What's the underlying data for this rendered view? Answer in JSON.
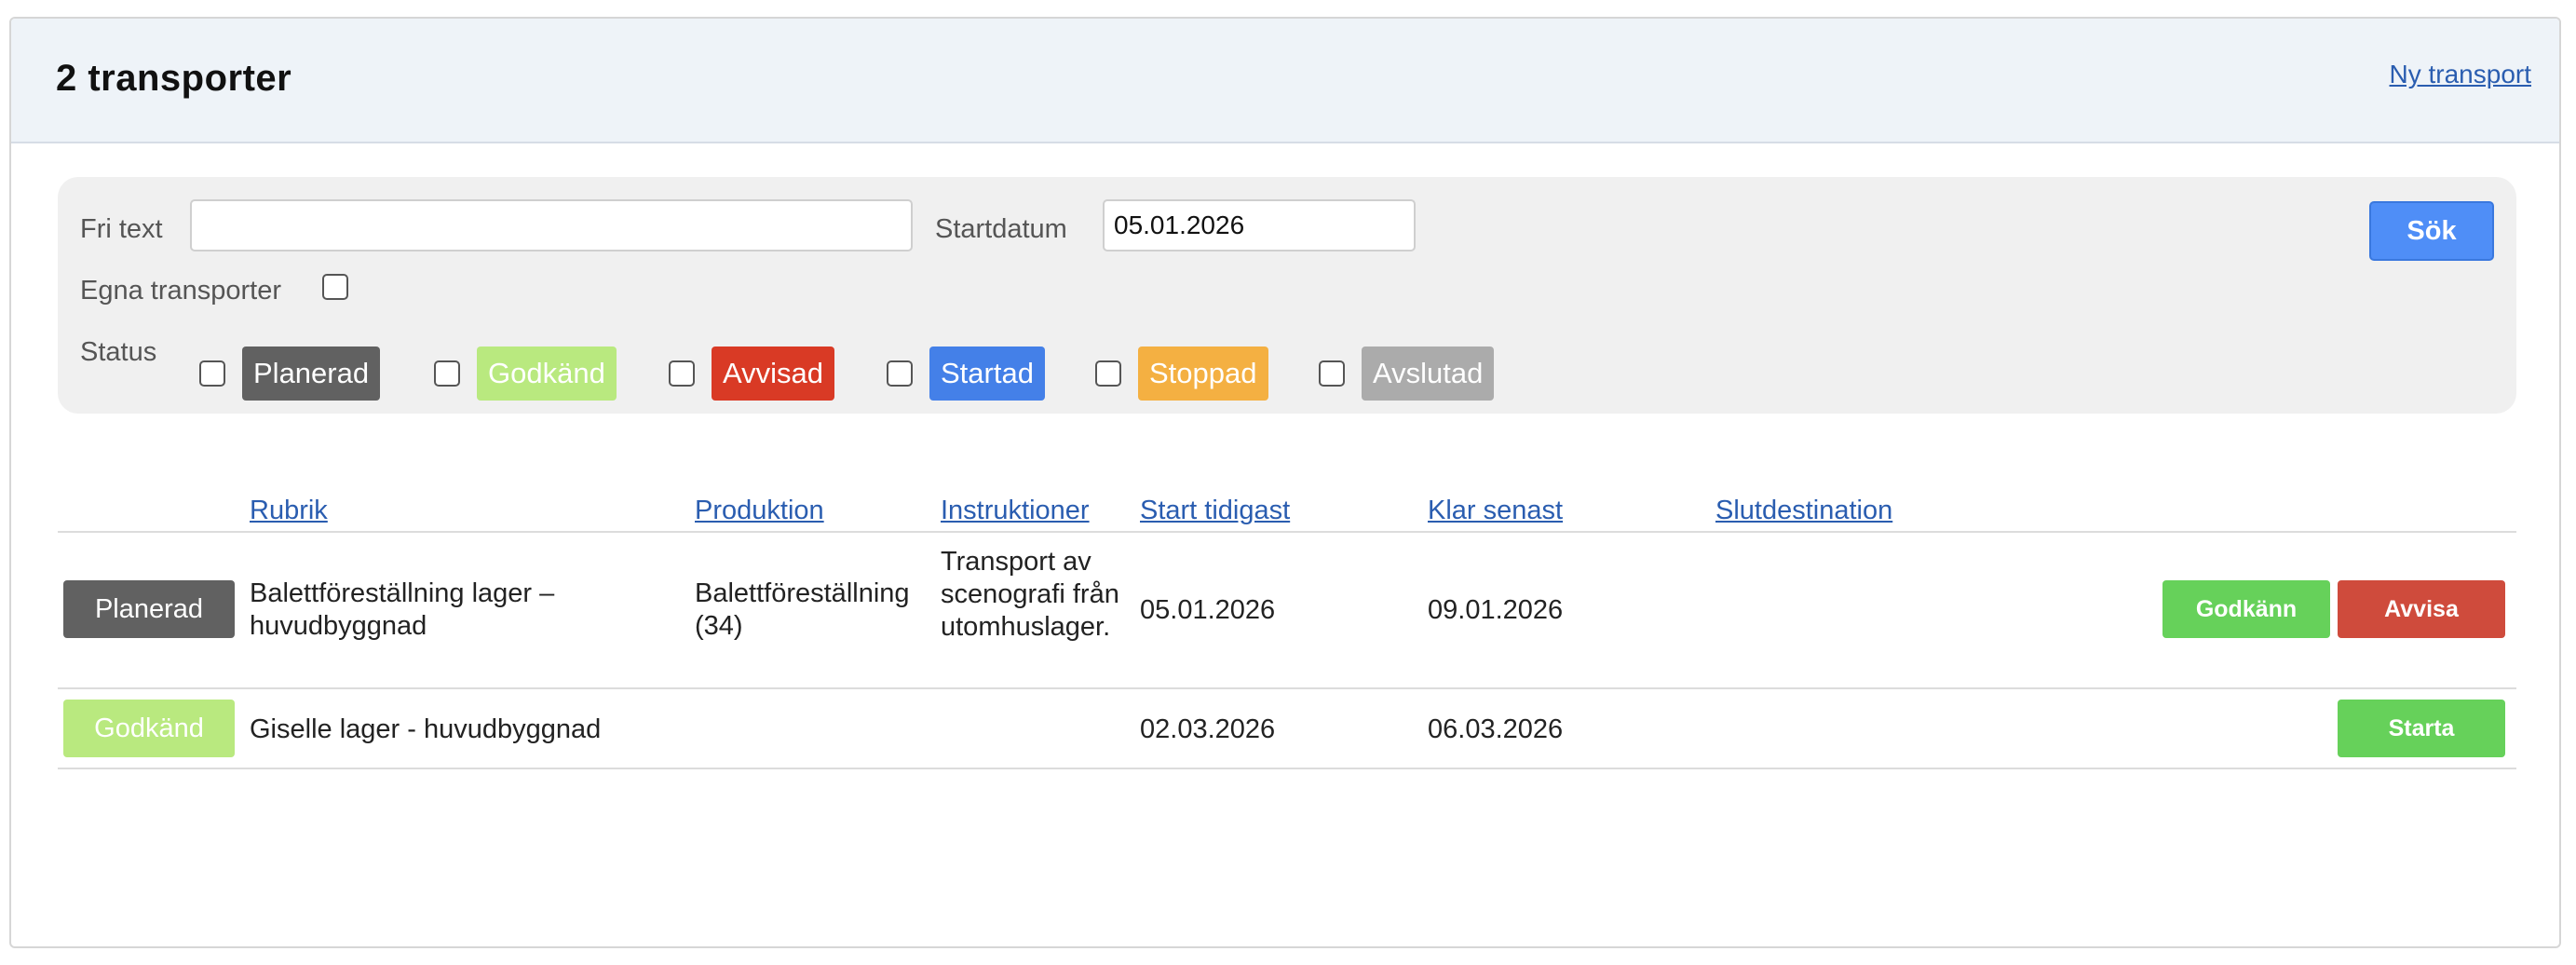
{
  "header": {
    "title": "2 transporter",
    "new_link": "Ny transport"
  },
  "filters": {
    "free_text_label": "Fri text",
    "free_text_value": "",
    "start_date_label": "Startdatum",
    "start_date_value": "05.01.2026",
    "search_label": "Sök",
    "own_label": "Egna transporter",
    "status_label": "Status",
    "statuses": [
      {
        "label": "Planerad",
        "color": "#616161"
      },
      {
        "label": "Godkänd",
        "color": "#b9e97f"
      },
      {
        "label": "Avvisad",
        "color": "#d93a25"
      },
      {
        "label": "Startad",
        "color": "#4480e8"
      },
      {
        "label": "Stoppad",
        "color": "#f4b042"
      },
      {
        "label": "Avslutad",
        "color": "#ababab"
      }
    ]
  },
  "table": {
    "columns": [
      "Rubrik",
      "Produktion",
      "Instruktioner",
      "Start tidigast",
      "Klar senast",
      "Slutdestination"
    ],
    "rows": [
      {
        "status": "Planerad",
        "status_color": "#616161",
        "rubrik": "Balettföreställning lager – huvudbyggnad",
        "produktion": "Balettföreställning (34)",
        "instruktioner": "Transport av scenografi från utomhuslager.",
        "start": "05.01.2026",
        "klar": "09.01.2026",
        "slutdestination": "",
        "actions": [
          {
            "label": "Godkänn",
            "color": "#66d15a"
          },
          {
            "label": "Avvisa",
            "color": "#cf4b3c"
          }
        ]
      },
      {
        "status": "Godkänd",
        "status_color": "#b9e97f",
        "rubrik": "Giselle lager - huvudbyggnad",
        "produktion": "",
        "instruktioner": "",
        "start": "02.03.2026",
        "klar": "06.03.2026",
        "slutdestination": "",
        "actions": [
          {
            "label": "Starta",
            "color": "#66d15a"
          }
        ]
      }
    ]
  }
}
